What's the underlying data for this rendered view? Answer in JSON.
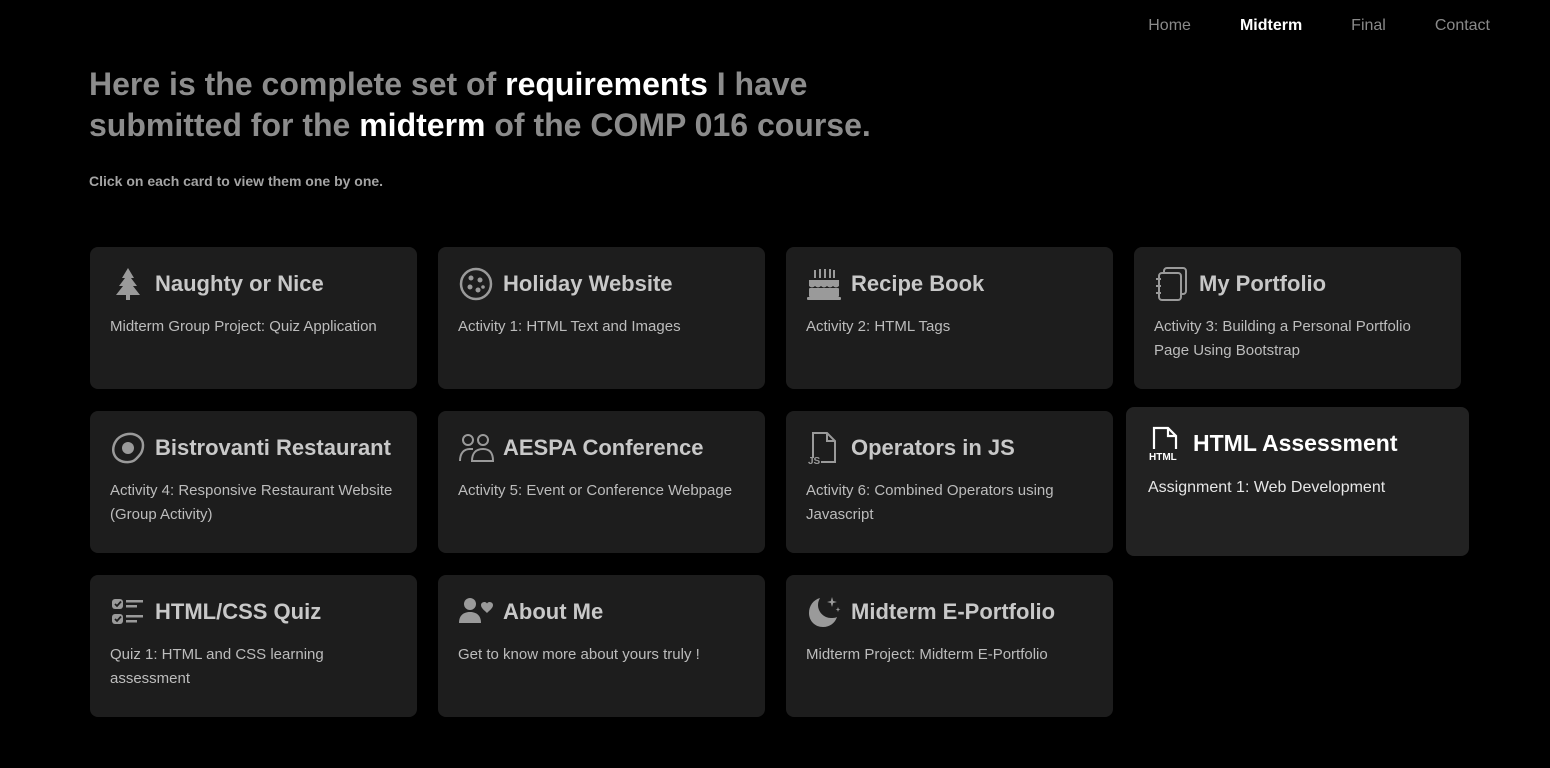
{
  "nav": {
    "items": [
      {
        "label": "Home",
        "active": false
      },
      {
        "label": "Midterm",
        "active": true
      },
      {
        "label": "Final",
        "active": false
      },
      {
        "label": "Contact",
        "active": false
      }
    ]
  },
  "hero": {
    "part1": "Here is the complete set of ",
    "highlight1": "requirements",
    "part2": " I have submitted for the ",
    "highlight2": "midterm",
    "part3": " of the COMP 016 course."
  },
  "subtitle": "Click on each card to view them one by one.",
  "cards": [
    {
      "icon": "tree-icon",
      "title": "Naughty or Nice",
      "desc": "Midterm Group Project: Quiz Application"
    },
    {
      "icon": "cookie-icon",
      "title": "Holiday Website",
      "desc": "Activity 1: HTML Text and Images"
    },
    {
      "icon": "cake-icon",
      "title": "Recipe Book",
      "desc": "Activity 2: HTML Tags"
    },
    {
      "icon": "journal-icon",
      "title": "My Portfolio",
      "desc": "Activity 3: Building a Personal Portfolio Page Using Bootstrap"
    },
    {
      "icon": "egg-icon",
      "title": "Bistrovanti Restaurant",
      "desc": "Activity 4: Responsive Restaurant Website (Group Activity)"
    },
    {
      "icon": "people-icon",
      "title": "AESPA Conference",
      "desc": "Activity 5: Event or Conference Webpage"
    },
    {
      "icon": "file-js-icon",
      "title": "Operators in JS",
      "desc": "Activity 6: Combined Operators using Javascript"
    },
    {
      "icon": "file-html-icon",
      "title": "HTML Assessment",
      "desc": "Assignment 1: Web Development"
    },
    {
      "icon": "checklist-icon",
      "title": "HTML/CSS Quiz",
      "desc": "Quiz 1: HTML and CSS learning assessment"
    },
    {
      "icon": "person-heart-icon",
      "title": "About Me",
      "desc": "Get to know more about yours truly !"
    },
    {
      "icon": "moon-stars-icon",
      "title": "Midterm E-Portfolio",
      "desc": "Midterm Project: Midterm E-Portfolio"
    }
  ]
}
